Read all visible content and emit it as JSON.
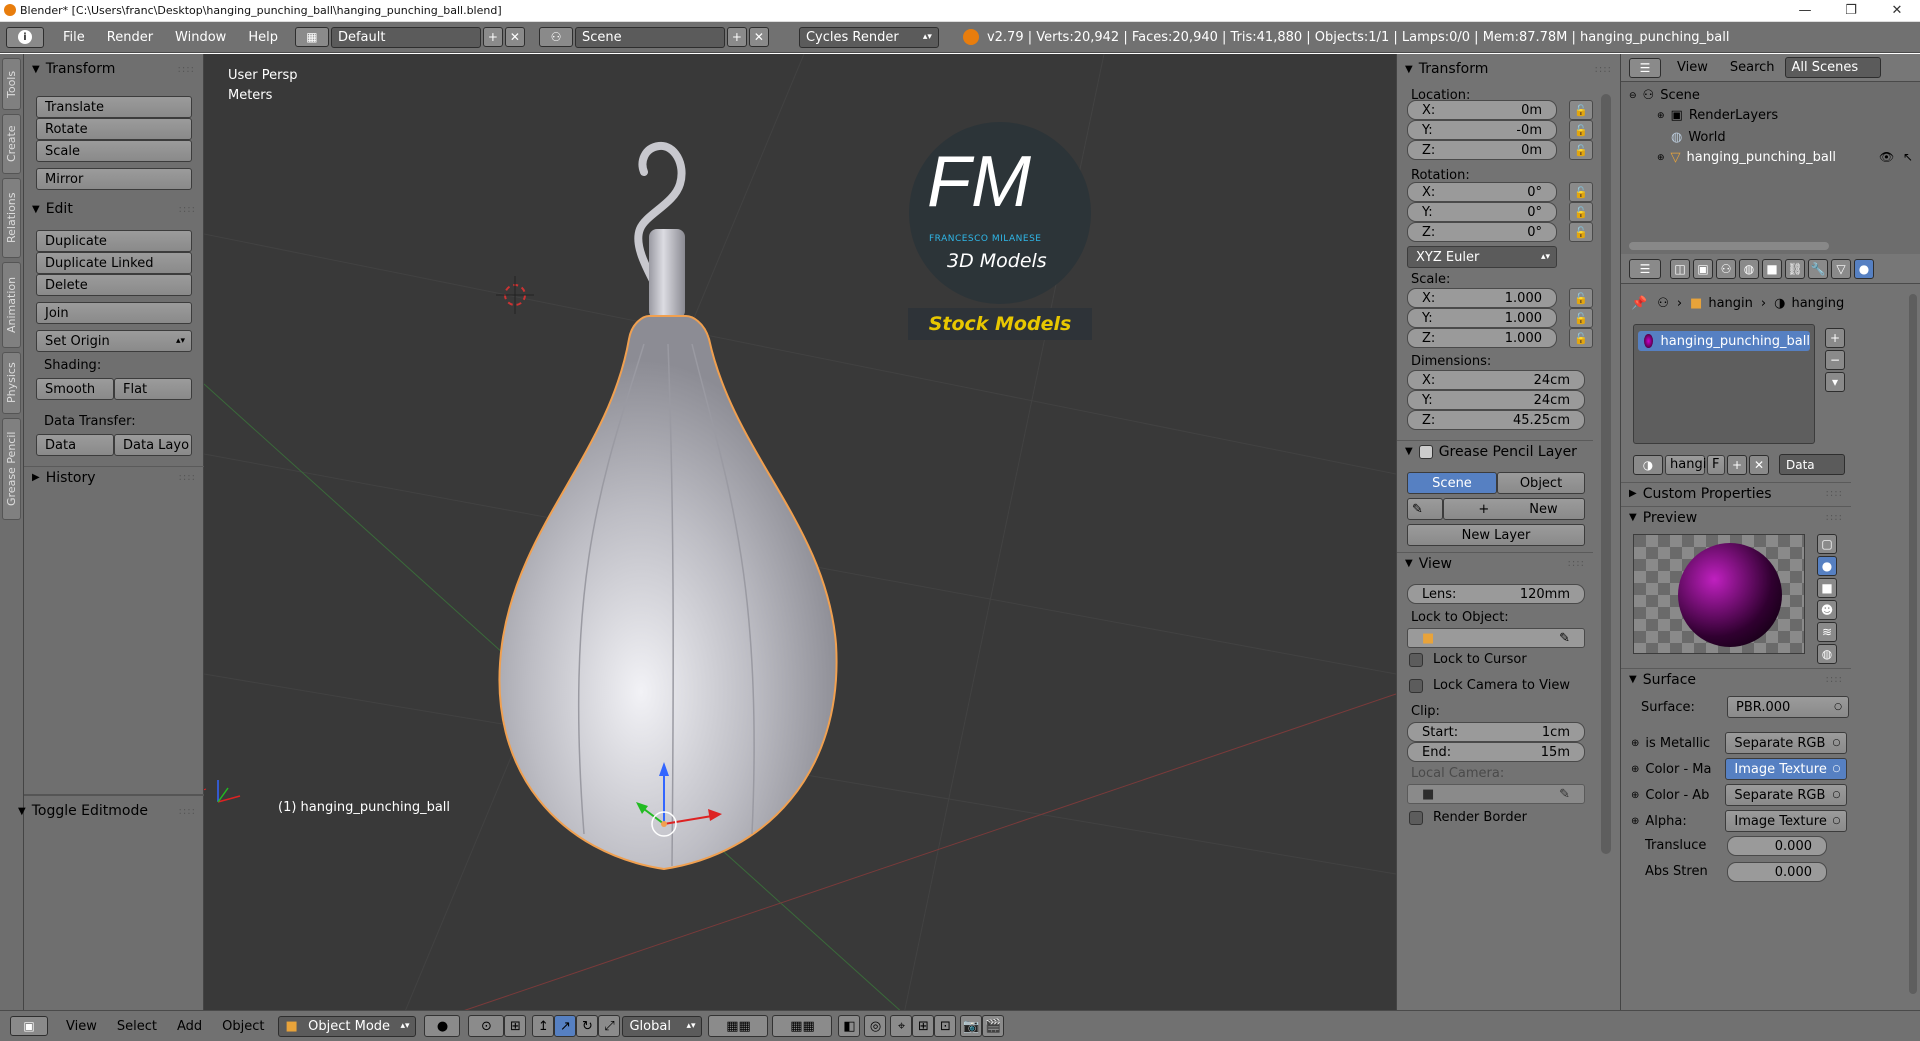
{
  "window": {
    "title": "Blender* [C:\\Users\\franc\\Desktop\\hanging_punching_ball\\hanging_punching_ball.blend]",
    "minimize": "—",
    "maximize": "❐",
    "close": "✕"
  },
  "topbar": {
    "info_icon": "i",
    "menus": [
      "File",
      "Render",
      "Window",
      "Help"
    ],
    "layout": "Default",
    "scene": "Scene",
    "engine": "Cycles Render",
    "stats": "v2.79 | Verts:20,942 | Faces:20,940 | Tris:41,880 | Objects:1/1 | Lamps:0/0 | Mem:87.78M | hanging_punching_ball"
  },
  "toolstrip": {
    "tabs": [
      "Tools",
      "Create",
      "Relations",
      "Animation",
      "Physics",
      "Grease Pencil"
    ]
  },
  "tools": {
    "transform_header": "Transform",
    "translate": "Translate",
    "rotate": "Rotate",
    "scale": "Scale",
    "mirror": "Mirror",
    "edit_header": "Edit",
    "duplicate": "Duplicate",
    "duplicate_linked": "Duplicate Linked",
    "delete": "Delete",
    "join": "Join",
    "set_origin": "Set Origin",
    "shading_label": "Shading:",
    "smooth": "Smooth",
    "flat": "Flat",
    "data_transfer_label": "Data Transfer:",
    "data": "Data",
    "data_layo": "Data Layo",
    "history_header": "History",
    "toggle_editmode": "Toggle Editmode"
  },
  "viewport": {
    "view_name": "User Persp",
    "units": "Meters",
    "object_label": "(1) hanging_punching_ball",
    "watermark": {
      "initials": "FM",
      "name": "FRANCESCO MILANESE",
      "sub": "3D Models",
      "badge": "Stock Models"
    }
  },
  "npanel": {
    "transform_header": "Transform",
    "location_label": "Location:",
    "loc": [
      {
        "axis": "X:",
        "value": "0m"
      },
      {
        "axis": "Y:",
        "value": "-0m"
      },
      {
        "axis": "Z:",
        "value": "0m"
      }
    ],
    "rotation_label": "Rotation:",
    "rot": [
      {
        "axis": "X:",
        "value": "0°"
      },
      {
        "axis": "Y:",
        "value": "0°"
      },
      {
        "axis": "Z:",
        "value": "0°"
      }
    ],
    "rotation_mode": "XYZ Euler",
    "scale_label": "Scale:",
    "scl": [
      {
        "axis": "X:",
        "value": "1.000"
      },
      {
        "axis": "Y:",
        "value": "1.000"
      },
      {
        "axis": "Z:",
        "value": "1.000"
      }
    ],
    "dimensions_label": "Dimensions:",
    "dim": [
      {
        "axis": "X:",
        "value": "24cm"
      },
      {
        "axis": "Y:",
        "value": "24cm"
      },
      {
        "axis": "Z:",
        "value": "45.25cm"
      }
    ],
    "gp_header": "Grease Pencil Layer",
    "gp_scene": "Scene",
    "gp_object": "Object",
    "gp_new": "New",
    "gp_new_layer": "New Layer",
    "view_header": "View",
    "lens_label": "Lens:",
    "lens_value": "120mm",
    "lock_to_object": "Lock to Object:",
    "lock_to_cursor": "Lock to Cursor",
    "lock_camera": "Lock Camera to View",
    "clip_label": "Clip:",
    "clip_start_label": "Start:",
    "clip_start": "1cm",
    "clip_end_label": "End:",
    "clip_end": "15m",
    "local_camera": "Local Camera:",
    "render_border": "Render Border"
  },
  "outliner": {
    "view": "View",
    "search": "Search",
    "filter": "All Scenes",
    "items": [
      "Scene",
      "RenderLayers",
      "World",
      "hanging_punching_ball"
    ]
  },
  "properties": {
    "breadcrumb": [
      "hangin",
      "hanging"
    ],
    "material_slot": "hanging_punching_ball",
    "material_name": "hangi",
    "fake_user": "F",
    "link": "Data",
    "custom_props": "Custom Properties",
    "preview": "Preview",
    "surface_header": "Surface",
    "surface_label": "Surface:",
    "surface_value": "PBR.000",
    "inputs": [
      {
        "label": "is Metallic",
        "value": "Separate RGB"
      },
      {
        "label": "Color - Ma",
        "value": "Image Texture"
      },
      {
        "label": "Color - Ab",
        "value": "Separate RGB"
      },
      {
        "label": "Alpha:",
        "value": "Image Texture"
      }
    ],
    "translucence_label": "Transluce",
    "translucence": "0.000",
    "abs_label": "Abs Stren",
    "abs": "0.000"
  },
  "bottombar": {
    "menus": [
      "View",
      "Select",
      "Add",
      "Object"
    ],
    "mode": "Object Mode",
    "orientation": "Global"
  },
  "colors": {
    "selection": "#5680c2",
    "object_outline": "#f0a050",
    "panel": "#737373",
    "viewport": "#393939"
  }
}
